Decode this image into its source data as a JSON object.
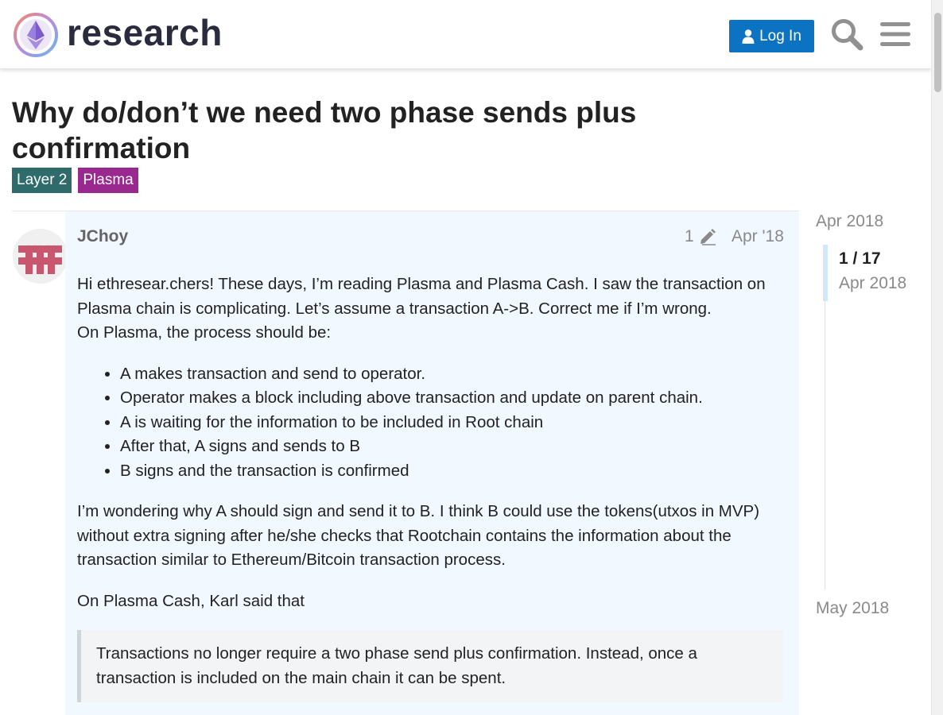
{
  "header": {
    "logo_text": "research",
    "login_label": "Log In"
  },
  "topic": {
    "title": "Why do/don’t we need two phase sends plus confirmation",
    "tags": [
      {
        "label": "Layer 2",
        "color": "#2f6b6b"
      },
      {
        "label": "Plasma",
        "color": "#99288f"
      }
    ]
  },
  "post": {
    "author": "JChoy",
    "edit_count": "1",
    "date": "Apr '18",
    "paragraphs": [
      "Hi ethresear.chers! These days, I’m reading Plasma and Plasma Cash. I saw the transaction on Plasma chain is complicating. Let’s assume a transaction A->B. Correct me if I’m wrong.\nOn Plasma, the process should be:",
      "I’m wondering why A should sign and send it to B. I think B could use the tokens(utxos in MVP) without extra signing after he/she checks that Rootchain contains the information about the transaction similar to Ethereum/Bitcoin transaction process.",
      "On Plasma Cash, Karl said that"
    ],
    "list_items": [
      "A makes transaction and send to operator.",
      "Operator makes a block including above transaction and update on parent chain.",
      "A is waiting for the information to be included in Root chain",
      "After that, A signs and sends to B",
      "B signs and the transaction is confirmed"
    ],
    "quote": "Transactions no longer require a two phase send plus confirmation. Instead, once a transaction is included on the main chain it can be spent."
  },
  "timeline": {
    "start_date": "Apr 2018",
    "position": "1 / 17",
    "current_date": "Apr 2018",
    "end_date": "May 2018"
  },
  "colors": {
    "accent": "#0c73c2",
    "post_background": "#f1f8ff"
  },
  "icons": [
    "research-logo-icon",
    "user-icon",
    "search-icon",
    "hamburger-menu-icon",
    "pencil-icon",
    "avatar-icon"
  ]
}
